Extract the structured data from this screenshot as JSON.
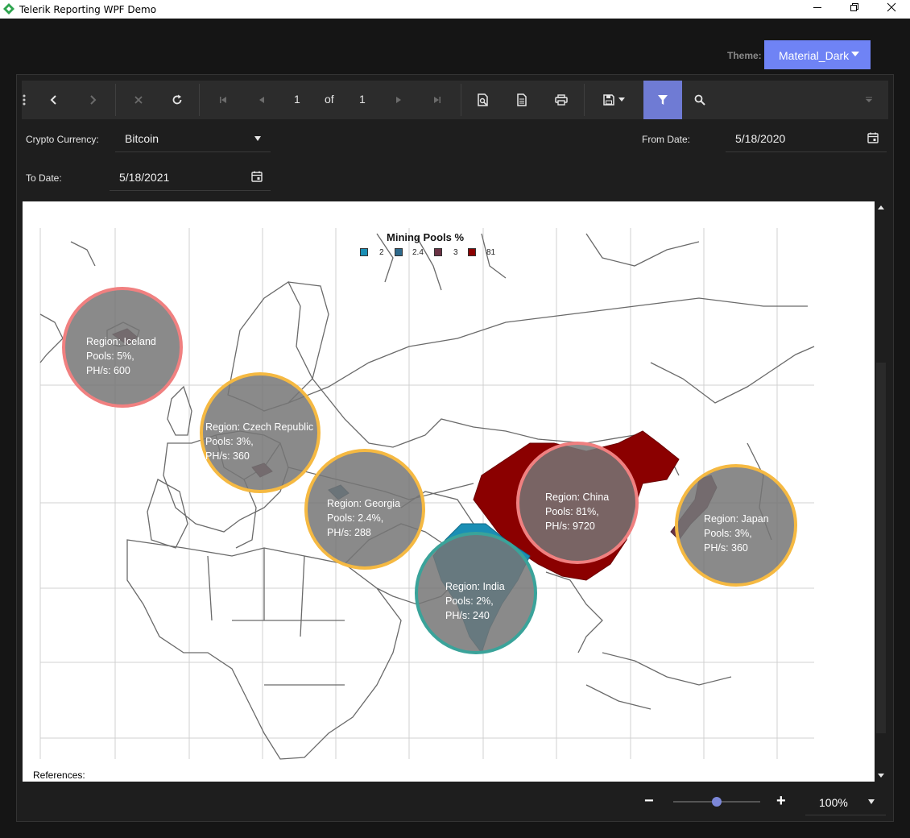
{
  "window": {
    "title": "Telerik Reporting WPF Demo",
    "minimize_icon": "minimize-icon",
    "maximize_icon": "restore-icon",
    "close_icon": "close-icon"
  },
  "theme": {
    "label": "Theme:",
    "value": "Material_Dark",
    "accent": "#6f83f5"
  },
  "toolbar": {
    "page_current": "1",
    "page_of": "of",
    "page_total": "1"
  },
  "params": {
    "crypto_label": "Crypto Currency:",
    "crypto_value": "Bitcoin",
    "from_label": "From Date:",
    "from_value": "5/18/2020",
    "to_label": "To Date:",
    "to_value": "5/18/2021"
  },
  "report": {
    "legend_title": "Mining Pools %",
    "legend": [
      {
        "label": "2",
        "color": "#1a8fb5"
      },
      {
        "label": "2.4",
        "color": "#2e6a8c"
      },
      {
        "label": "3",
        "color": "#6a3344"
      },
      {
        "label": "81",
        "color": "#8b0000"
      }
    ],
    "bubbles": [
      {
        "line1": "Region: Iceland",
        "line2": "Pools: 5%,",
        "line3": "PH/s: 600",
        "border": "#f08080"
      },
      {
        "line1": "Region: Czech Republic",
        "line2": "Pools: 3%,",
        "line3": "PH/s: 360",
        "border": "#f5b942"
      },
      {
        "line1": "Region: Georgia",
        "line2": "Pools: 2.4%,",
        "line3": "PH/s: 288",
        "border": "#f5b942"
      },
      {
        "line1": "Region: China",
        "line2": "Pools: 81%,",
        "line3": "PH/s: 9720",
        "border": "#f08080"
      },
      {
        "line1": "Region: India",
        "line2": "Pools: 2%,",
        "line3": "PH/s: 240",
        "border": "#3aa39a"
      },
      {
        "line1": "Region: Japan",
        "line2": "Pools: 3%,",
        "line3": "PH/s: 360",
        "border": "#f5b942"
      }
    ],
    "references": "References:"
  },
  "zoom": {
    "minus": "−",
    "plus": "+",
    "value": "100%",
    "level_percent": 50
  }
}
